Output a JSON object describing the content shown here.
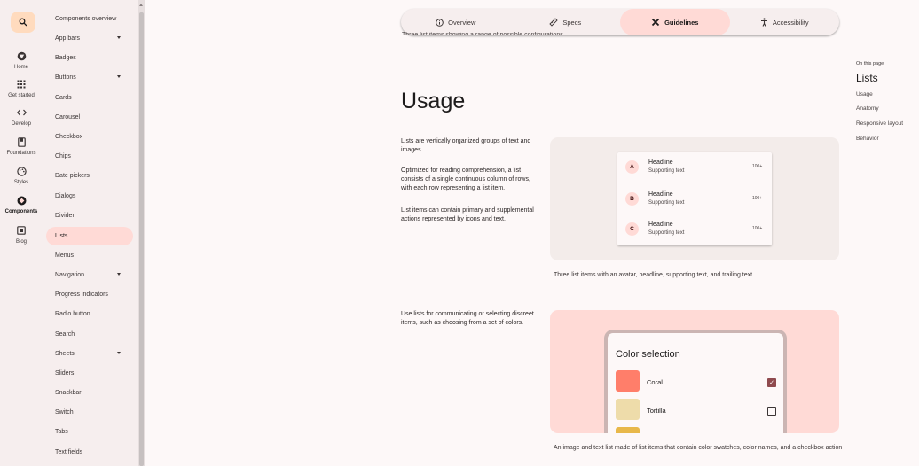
{
  "rail": {
    "items": [
      {
        "label": "Home",
        "icon": "material-logo-icon"
      },
      {
        "label": "Get started",
        "icon": "apps-grid-icon"
      },
      {
        "label": "Develop",
        "icon": "code-icon"
      },
      {
        "label": "Foundations",
        "icon": "book-icon"
      },
      {
        "label": "Styles",
        "icon": "palette-icon"
      },
      {
        "label": "Components",
        "icon": "components-icon"
      },
      {
        "label": "Blog",
        "icon": "blog-icon"
      }
    ],
    "active": "Components"
  },
  "sidebar": {
    "items": [
      {
        "label": "Components overview",
        "expandable": false
      },
      {
        "label": "App bars",
        "expandable": true
      },
      {
        "label": "Badges",
        "expandable": false
      },
      {
        "label": "Buttons",
        "expandable": true
      },
      {
        "label": "Cards",
        "expandable": false
      },
      {
        "label": "Carousel",
        "expandable": false
      },
      {
        "label": "Checkbox",
        "expandable": false
      },
      {
        "label": "Chips",
        "expandable": false
      },
      {
        "label": "Date pickers",
        "expandable": false
      },
      {
        "label": "Dialogs",
        "expandable": false
      },
      {
        "label": "Divider",
        "expandable": false
      },
      {
        "label": "Lists",
        "expandable": false
      },
      {
        "label": "Menus",
        "expandable": false
      },
      {
        "label": "Navigation",
        "expandable": true
      },
      {
        "label": "Progress indicators",
        "expandable": false
      },
      {
        "label": "Radio button",
        "expandable": false
      },
      {
        "label": "Search",
        "expandable": false
      },
      {
        "label": "Sheets",
        "expandable": true
      },
      {
        "label": "Sliders",
        "expandable": false
      },
      {
        "label": "Snackbar",
        "expandable": false
      },
      {
        "label": "Switch",
        "expandable": false
      },
      {
        "label": "Tabs",
        "expandable": false
      },
      {
        "label": "Text fields",
        "expandable": false
      }
    ],
    "active": "Lists"
  },
  "tabs": {
    "items": [
      {
        "label": "Overview",
        "icon": "info-icon"
      },
      {
        "label": "Specs",
        "icon": "ruler-icon"
      },
      {
        "label": "Guidelines",
        "icon": "tools-icon"
      },
      {
        "label": "Accessibility",
        "icon": "accessibility-icon"
      }
    ],
    "active": "Guidelines"
  },
  "content": {
    "clipped_caption": "Three list items showing a range of possible configurations",
    "heading": "Usage",
    "para1": "Lists are vertically organized groups of text and images.",
    "para2": "Optimized for reading comprehension, a list consists of a single continuous column of rows, with each row representing a list item.",
    "para3": "List items can contain primary and supplemental actions represented by icons and text.",
    "figure1": {
      "items": [
        {
          "avatar": "A",
          "headline": "Headline",
          "supporting": "Supporting text",
          "trailing": "100+"
        },
        {
          "avatar": "B",
          "headline": "Headline",
          "supporting": "Supporting text",
          "trailing": "100+"
        },
        {
          "avatar": "C",
          "headline": "Headline",
          "supporting": "Supporting text",
          "trailing": "100+"
        }
      ],
      "caption": "Three list items with an avatar, headline, supporting text, and trailing text"
    },
    "para4": "Use lists for communicating or selecting discreet items, such as choosing from a set of colors.",
    "figure2": {
      "title": "Color selection",
      "items": [
        {
          "label": "Coral",
          "color": "#ff7e6a",
          "checked": true
        },
        {
          "label": "Tortilla",
          "color": "#eedcaa",
          "checked": false
        },
        {
          "label": "",
          "color": "#e8b84a",
          "checked": false
        }
      ],
      "caption": "An image and text list made of list items that contain color swatches, color names, and a checkbox action"
    }
  },
  "toc": {
    "label": "On this page",
    "title": "Lists",
    "links": [
      "Usage",
      "Anatomy",
      "Responsive layout",
      "Behavior"
    ]
  },
  "colors": {
    "accent": "#ffdad6",
    "search_bg": "#ffdbbe",
    "checkbox_checked": "#8f4a4e"
  }
}
